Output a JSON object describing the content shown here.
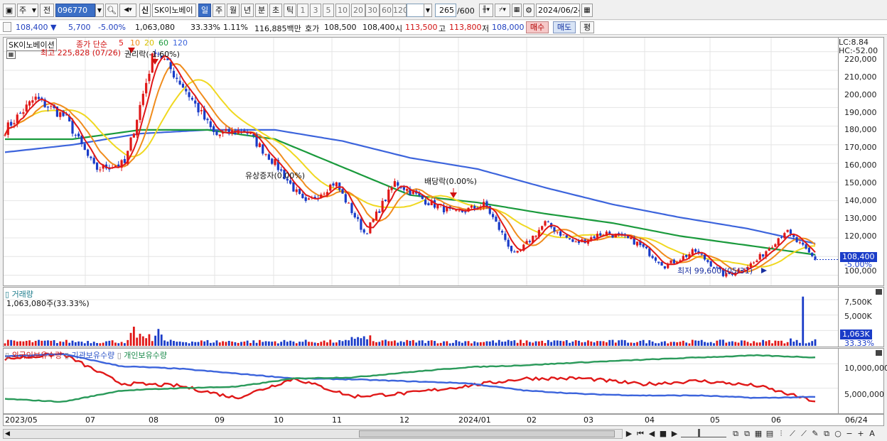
{
  "toolbar": {
    "market_type": "주",
    "prev_label": "전",
    "stock_code": "096770",
    "stock_name": "SK이노베이",
    "credit_badge": "신",
    "period_tabs": [
      "일",
      "주",
      "월",
      "년",
      "분",
      "초",
      "틱"
    ],
    "active_period": "일",
    "intervals": [
      "1",
      "3",
      "5",
      "10",
      "20",
      "30",
      "60",
      "120"
    ],
    "count_display": "265",
    "count_total": "/600",
    "date": "2024/06/24"
  },
  "quote": {
    "price": "108,400",
    "change": "5,700",
    "change_pct": "-5.00%",
    "volume": "1,063,080",
    "volume_ratio": "33.33%",
    "turnover": "1.11%",
    "amount": "116,885백만",
    "bid_label": "호가",
    "bid": "108,500",
    "ask": "108,400",
    "open_label": "시",
    "open": "113,500",
    "high_label": "고",
    "high": "113,800",
    "low_label": "저",
    "low": "108,000",
    "buy_button": "매수",
    "sell_button": "매도",
    "eval_button": "평"
  },
  "price_panel": {
    "title": "SK이노베이션",
    "ma_label": "종가 단순",
    "ma_periods": [
      "5",
      "10",
      "20",
      "60",
      "120"
    ],
    "lc_label": "LC:8.84",
    "hc_label": "HC:-52.00",
    "high_annotation": "최고 225,828 (07/26)",
    "low_annotation": "최저 99,600 (05/31)",
    "events": [
      "권리락(-1.60%)",
      "유상증자(0.00%)",
      "배당락(0.00%)"
    ],
    "y_ticks": [
      "220,000",
      "210,000",
      "200,000",
      "190,000",
      "180,000",
      "170,000",
      "160,000",
      "150,000",
      "140,000",
      "130,000",
      "120,000",
      "110,000",
      "100,000"
    ],
    "current_price_tag": "108,400",
    "current_pct_tag": "-5.00%"
  },
  "volume_panel": {
    "title": "거래량",
    "value_label": "1,063,080주(33.33%)",
    "y_ticks": [
      "7,500K",
      "5,000K",
      "2,500K"
    ],
    "current_tag": "1,063K",
    "current_pct": "33.33%"
  },
  "holdings_panel": {
    "series_labels": [
      "외국인보유수량",
      "기관보유수량",
      "개인보유수량"
    ],
    "y_ticks": [
      "10,000,000",
      "5,000,000"
    ]
  },
  "x_axis": {
    "labels": [
      "2023/05",
      "07",
      "08",
      "09",
      "10",
      "11",
      "12",
      "2024/01",
      "02",
      "03",
      "04",
      "05",
      "06"
    ],
    "right_label": "06/24"
  },
  "colors": {
    "ma5": "#e01818",
    "ma10": "#f08c1c",
    "ma20": "#f0d820",
    "ma60": "#1a9a3c",
    "ma120": "#3c64dc",
    "up_candle": "#e01818",
    "down_candle": "#1a3cc8",
    "foreign": "#e01818",
    "institution": "#3c64dc",
    "individual": "#2a9a5a"
  },
  "chart_data": [
    {
      "type": "candlestick",
      "title": "SK이노베이션",
      "ylim": [
        96000,
        226000
      ],
      "x_range": [
        "2023/05",
        "2024/06/24"
      ],
      "close_path": [
        [
          "2023/05",
          178000
        ],
        [
          "2023/06",
          195000
        ],
        [
          "2023/06 late",
          185000
        ],
        [
          "2023/07 early",
          157000
        ],
        [
          "2023/07 mid",
          160000
        ],
        [
          "2023/07/26",
          222000
        ],
        [
          "2023/08 early",
          200000
        ],
        [
          "2023/08 late",
          175000
        ],
        [
          "2023/09",
          178000
        ],
        [
          "2023/10 early",
          160000
        ],
        [
          "2023/10 late",
          138000
        ],
        [
          "2023/11 early",
          150000
        ],
        [
          "2023/11 mid",
          122000
        ],
        [
          "2023/11 late",
          150000
        ],
        [
          "2023/12",
          140000
        ],
        [
          "2024/01 early",
          133000
        ],
        [
          "2024/01 late",
          138000
        ],
        [
          "2024/02 early",
          110000
        ],
        [
          "2024/02 late",
          128000
        ],
        [
          "2024/03",
          117000
        ],
        [
          "2024/03 late",
          123000
        ],
        [
          "2024/04",
          118000
        ],
        [
          "2024/04 late",
          105000
        ],
        [
          "2024/05",
          113000
        ],
        [
          "2024/05/31",
          99600
        ],
        [
          "2024/06 mid",
          107000
        ],
        [
          "2024/06 late",
          124000
        ],
        [
          "2024/06/24",
          108400
        ]
      ],
      "ma60_path": [
        [
          "2023/05",
          173000
        ],
        [
          "2023/07",
          173000
        ],
        [
          "2023/08",
          178000
        ],
        [
          "2023/09",
          178000
        ],
        [
          "2023/10",
          173000
        ],
        [
          "2023/11",
          158000
        ],
        [
          "2023/12",
          143000
        ],
        [
          "2024/01",
          139000
        ],
        [
          "2024/02",
          133000
        ],
        [
          "2024/03",
          128000
        ],
        [
          "2024/04",
          121000
        ],
        [
          "2024/05",
          116000
        ],
        [
          "2024/06/24",
          111000
        ]
      ],
      "ma120_path": [
        [
          "2023/05",
          166000
        ],
        [
          "2023/07",
          170000
        ],
        [
          "2023/08",
          176000
        ],
        [
          "2023/09",
          178000
        ],
        [
          "2023/10",
          178000
        ],
        [
          "2023/11",
          172000
        ],
        [
          "2023/12",
          163000
        ],
        [
          "2024/01",
          157000
        ],
        [
          "2024/02",
          147000
        ],
        [
          "2024/03",
          138000
        ],
        [
          "2024/04",
          131000
        ],
        [
          "2024/05",
          125000
        ],
        [
          "2024/06/24",
          117000
        ]
      ]
    },
    {
      "type": "bar",
      "title": "거래량",
      "ylim": [
        0,
        9000000
      ],
      "notable_values": [
        [
          "2023/07/26",
          3200000
        ],
        [
          "2023/11",
          1900000
        ],
        [
          "2024/06 early",
          1200000
        ],
        [
          "2024/06 late",
          8000000
        ],
        [
          "2024/06/24",
          1063080
        ]
      ]
    },
    {
      "type": "line",
      "ylim": [
        0,
        12500000
      ],
      "series": [
        {
          "name": "외국인보유수량",
          "values": [
            [
              "2023/05",
              11000000
            ],
            [
              "2023/06",
              12000000
            ],
            [
              "2023/07",
              6000000
            ],
            [
              "2023/08",
              5500000
            ],
            [
              "2023/09",
              3000000
            ],
            [
              "2023/10",
              7000000
            ],
            [
              "2023/11",
              3300000
            ],
            [
              "2023/12",
              4000000
            ],
            [
              "2024/01",
              5500000
            ],
            [
              "2024/02",
              7000000
            ],
            [
              "2024/03",
              7000000
            ],
            [
              "2024/04",
              5800000
            ],
            [
              "2024/05",
              6500000
            ],
            [
              "2024/06",
              5500000
            ],
            [
              "2024/06/24",
              2300000
            ]
          ]
        },
        {
          "name": "기관보유수량",
          "values": [
            [
              "2023/05",
              11500000
            ],
            [
              "2023/06",
              12000000
            ],
            [
              "2023/07",
              9500000
            ],
            [
              "2023/08",
              9000000
            ],
            [
              "2023/09",
              8000000
            ],
            [
              "2023/10",
              7000000
            ],
            [
              "2023/11",
              6800000
            ],
            [
              "2023/12",
              6400000
            ],
            [
              "2024/01",
              6000000
            ],
            [
              "2024/02",
              4500000
            ],
            [
              "2024/03",
              3800000
            ],
            [
              "2024/04",
              3500000
            ],
            [
              "2024/05",
              3500000
            ],
            [
              "2024/06",
              3000000
            ],
            [
              "2024/06/24",
              3200000
            ]
          ]
        },
        {
          "name": "개인보유수량",
          "values": [
            [
              "2023/05",
              2800000
            ],
            [
              "2023/06",
              2200000
            ],
            [
              "2023/07",
              4500000
            ],
            [
              "2023/08",
              5000000
            ],
            [
              "2023/09",
              5300000
            ],
            [
              "2023/10",
              7000000
            ],
            [
              "2023/11",
              7200000
            ],
            [
              "2023/12",
              8300000
            ],
            [
              "2024/01",
              9300000
            ],
            [
              "2024/02",
              9700000
            ],
            [
              "2024/03",
              10300000
            ],
            [
              "2024/04",
              10800000
            ],
            [
              "2024/05",
              11300000
            ],
            [
              "2024/06",
              11700000
            ],
            [
              "2024/06/24",
              11300000
            ]
          ]
        }
      ]
    }
  ]
}
